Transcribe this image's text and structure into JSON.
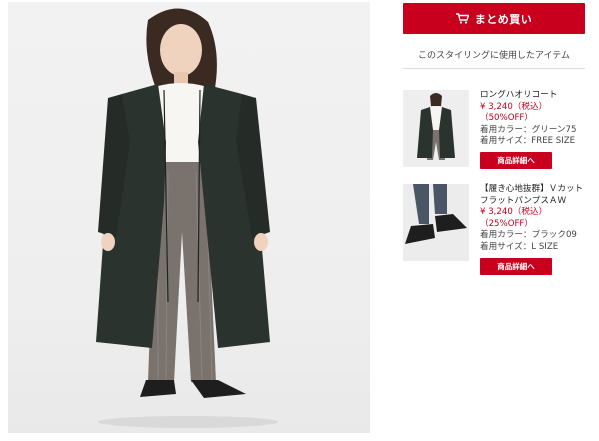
{
  "buy": {
    "label": "まとめ買い",
    "icon": "cart-icon"
  },
  "section": {
    "heading": "このスタイリングに使用したアイテム"
  },
  "items": [
    {
      "name": "ロングハオリコート",
      "price": "¥ 3,240（税込）",
      "discount": "（50%OFF）",
      "color": "着用カラー：グリーン75",
      "size": "着用サイズ：FREE SIZE",
      "button": "商品詳細へ"
    },
    {
      "name": "【履き心地抜群】ＶカットフラットパンプスＡＷ",
      "price": "¥ 3,240（税込）",
      "discount": "（25%OFF）",
      "color": "着用カラー：ブラック09",
      "size": "着用サイズ：L SIZE",
      "button": "商品詳細へ"
    }
  ],
  "colors": {
    "accent": "#c8001e",
    "coat": "#2b332f",
    "trousers": "#7a736d"
  }
}
